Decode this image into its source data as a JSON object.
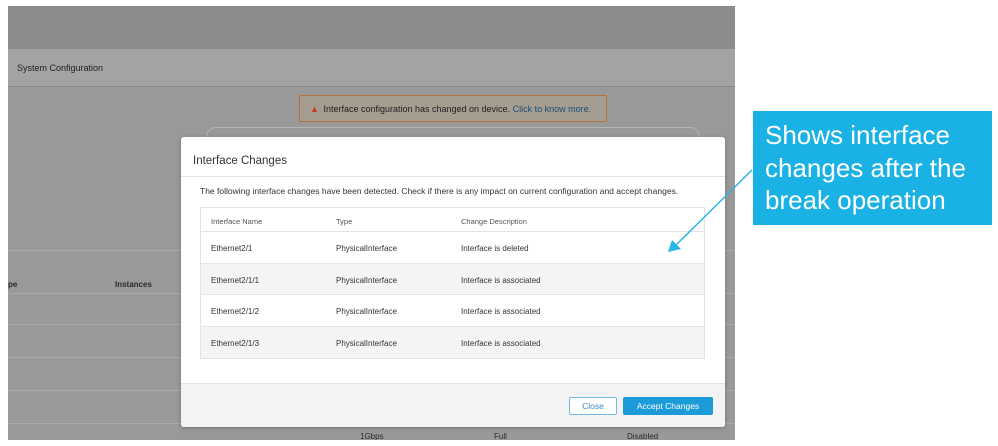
{
  "background_app": {
    "title": "System Configuration",
    "banner": {
      "message": "Interface configuration has changed on device.",
      "link": "Click to know more."
    },
    "list_headers": {
      "type_fragment": "pe",
      "instances": "Instances"
    },
    "bottom_row": {
      "speed": "1Gbps",
      "duplex": "Full",
      "state": "Disabled"
    }
  },
  "modal": {
    "title": "Interface Changes",
    "description": "The following interface changes have been detected. Check if there is any impact on current configuration and accept changes.",
    "table": {
      "headers": [
        "Interface Name",
        "Type",
        "Change Description"
      ],
      "rows": [
        [
          "Ethernet2/1",
          "PhysicalInterface",
          "Interface is deleted"
        ],
        [
          "Ethernet2/1/1",
          "PhysicalInterface",
          "Interface is associated"
        ],
        [
          "Ethernet2/1/2",
          "PhysicalInterface",
          "Interface is associated"
        ],
        [
          "Ethernet2/1/3",
          "PhysicalInterface",
          "Interface is associated"
        ]
      ]
    },
    "buttons": {
      "close": "Close",
      "accept": "Accept Changes"
    }
  },
  "callout": {
    "lines": [
      "Shows interface",
      "changes after the",
      "break operation"
    ]
  },
  "icons": {
    "banner_icon": "warning-triangle-icon"
  },
  "colors": {
    "callout_bg": "#1ab1e5",
    "primary_button": "#1b9bd8",
    "overlay": "#9a9a9a",
    "warning": "#c43d1c"
  }
}
